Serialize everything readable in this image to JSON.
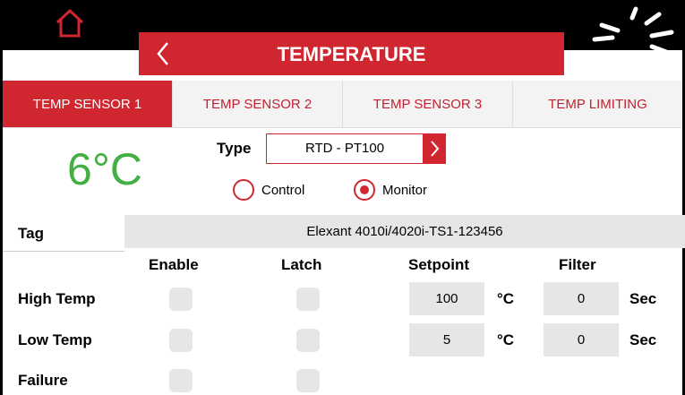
{
  "header": {
    "title": "TEMPERATURE"
  },
  "tabs": [
    {
      "label": "TEMP SENSOR 1",
      "active": true
    },
    {
      "label": "TEMP SENSOR 2",
      "active": false
    },
    {
      "label": "TEMP SENSOR 3",
      "active": false
    },
    {
      "label": "TEMP LIMITING",
      "active": false
    }
  ],
  "sensor": {
    "reading": "6°C",
    "type_label": "Type",
    "type_value": "RTD - PT100",
    "mode_options": [
      "Control",
      "Monitor"
    ],
    "mode_selected": "Monitor",
    "tag_label": "Tag",
    "tag_value": "Elexant 4010i/4020i-TS1-123456"
  },
  "table": {
    "columns": {
      "enable": "Enable",
      "latch": "Latch",
      "setpoint": "Setpoint",
      "filter": "Filter"
    },
    "rows": [
      {
        "label": "High Temp",
        "setpoint": "100",
        "setpoint_unit": "°C",
        "filter": "0",
        "filter_unit": "Sec"
      },
      {
        "label": "Low Temp",
        "setpoint": "5",
        "setpoint_unit": "°C",
        "filter": "0",
        "filter_unit": "Sec"
      },
      {
        "label": "Failure"
      }
    ]
  },
  "colors": {
    "accent": "#d0262f",
    "reading": "#44b044",
    "field_bg": "#e6e6e6"
  },
  "icons": {
    "home": "home-icon",
    "back": "chevron-left-icon",
    "dropdown": "chevron-right-icon",
    "busy": "spinner-icon"
  }
}
